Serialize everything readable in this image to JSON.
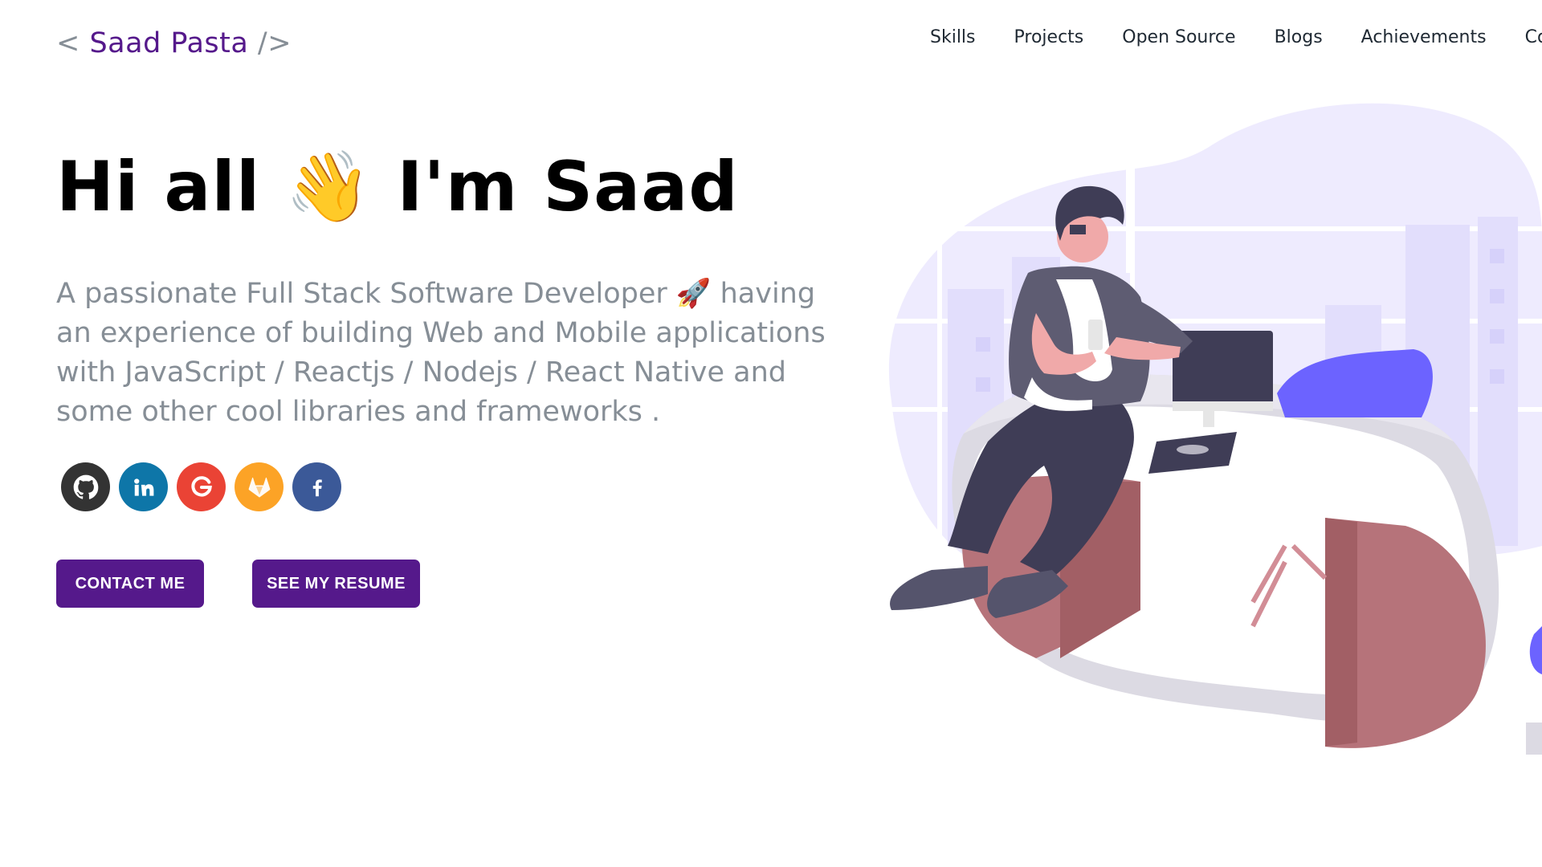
{
  "header": {
    "logo_open": "< ",
    "logo_name": "Saad Pasta",
    "logo_close": " />",
    "nav": [
      "Skills",
      "Projects",
      "Open Source",
      "Blogs",
      "Achievements",
      "Contact Me"
    ]
  },
  "hero": {
    "greeting_pre": "Hi all ",
    "wave_emoji": "👋",
    "greeting_post": " I'm Saad",
    "subtitle": "A passionate Full Stack Software Developer 🚀 having an experience of building Web and Mobile applications with JavaScript / Reactjs / Nodejs / React Native and some other cool libraries and frameworks .",
    "contact_button": "CONTACT ME",
    "resume_button": "SEE MY RESUME"
  },
  "socials": [
    {
      "icon": "github-icon",
      "color": "#333333"
    },
    {
      "icon": "linkedin-icon",
      "color": "#0e76a8"
    },
    {
      "icon": "google-icon",
      "color": "#ea4335"
    },
    {
      "icon": "gitlab-icon",
      "color": "#fca326"
    },
    {
      "icon": "facebook-icon",
      "color": "#3b5998"
    }
  ],
  "colors": {
    "brand": "#55198b",
    "subtitle": "#868e96"
  }
}
